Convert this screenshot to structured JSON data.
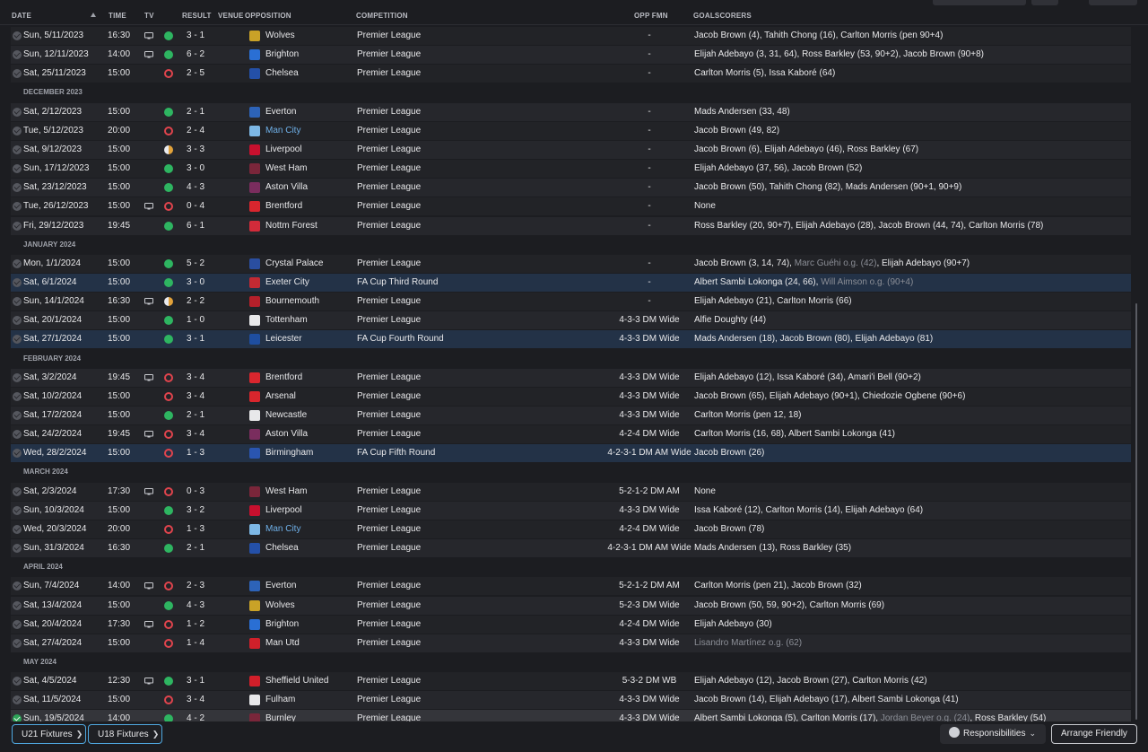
{
  "headers": {
    "date": "DATE",
    "time": "TIME",
    "tv": "TV",
    "result": "RESULT",
    "venue": "VENUE",
    "opposition": "OPPOSITION",
    "competition": "COMPETITION",
    "opp_fmn": "OPP FMN",
    "goalscorers": "GOALSCORERS"
  },
  "colors": {
    "win": "#2eb561",
    "loss": "#e0444d",
    "draw": "#e2a23a",
    "cup_row": "#233247",
    "man_city_link": "#6fb0e8",
    "button_border": "#4fa8e0"
  },
  "sections": [
    {
      "month": "",
      "fixtures": [
        {
          "date": "Sun, 5/11/2023",
          "time": "16:30",
          "tv": true,
          "result": "W",
          "score": "3 - 1",
          "venue": "A",
          "opponent": "Wolves",
          "crest": "#c9a227",
          "competition": "Premier League",
          "opp_fmn": "-",
          "goals": [
            {
              "t": "Jacob Brown (4), Tahith Chong (16), Carlton Morris (pen 90+4)"
            }
          ]
        },
        {
          "date": "Sun, 12/11/2023",
          "time": "14:00",
          "tv": true,
          "result": "W",
          "score": "6 - 2",
          "venue": "H",
          "opponent": "Brighton",
          "crest": "#2a6fd4",
          "competition": "Premier League",
          "opp_fmn": "-",
          "goals": [
            {
              "t": "Elijah Adebayo (3, 31, 64), Ross Barkley (53, 90+2), Jacob Brown (90+8)"
            }
          ]
        },
        {
          "date": "Sat, 25/11/2023",
          "time": "15:00",
          "tv": false,
          "result": "L",
          "score": "2 - 5",
          "venue": "A",
          "opponent": "Chelsea",
          "crest": "#2450a8",
          "competition": "Premier League",
          "opp_fmn": "-",
          "goals": [
            {
              "t": "Carlton Morris (5), Issa Kaboré (64)"
            }
          ]
        }
      ]
    },
    {
      "month": "DECEMBER 2023",
      "fixtures": [
        {
          "date": "Sat, 2/12/2023",
          "time": "15:00",
          "tv": false,
          "result": "W",
          "score": "2 - 1",
          "venue": "H",
          "opponent": "Everton",
          "crest": "#2d63b8",
          "competition": "Premier League",
          "opp_fmn": "-",
          "goals": [
            {
              "t": "Mads Andersen (33, 48)"
            }
          ]
        },
        {
          "date": "Tue, 5/12/2023",
          "time": "20:00",
          "tv": false,
          "result": "L",
          "score": "2 - 4",
          "venue": "H",
          "opponent": "Man City",
          "crest": "#7db8e6",
          "link": true,
          "competition": "Premier League",
          "opp_fmn": "-",
          "goals": [
            {
              "t": "Jacob Brown (49, 82)"
            }
          ]
        },
        {
          "date": "Sat, 9/12/2023",
          "time": "15:00",
          "tv": false,
          "result": "D",
          "score": "3 - 3",
          "venue": "A",
          "opponent": "Liverpool",
          "crest": "#c8102e",
          "competition": "Premier League",
          "opp_fmn": "-",
          "goals": [
            {
              "t": "Jacob Brown (6), Elijah Adebayo (46), Ross Barkley (67)"
            }
          ]
        },
        {
          "date": "Sun, 17/12/2023",
          "time": "15:00",
          "tv": false,
          "result": "W",
          "score": "3 - 0",
          "venue": "H",
          "opponent": "West Ham",
          "crest": "#7a263a",
          "competition": "Premier League",
          "opp_fmn": "-",
          "goals": [
            {
              "t": "Elijah Adebayo (37, 56), Jacob Brown (52)"
            }
          ]
        },
        {
          "date": "Sat, 23/12/2023",
          "time": "15:00",
          "tv": false,
          "result": "W",
          "score": "4 - 3",
          "venue": "A",
          "opponent": "Aston Villa",
          "crest": "#7a2d5e",
          "competition": "Premier League",
          "opp_fmn": "-",
          "goals": [
            {
              "t": "Jacob Brown (50), Tahith Chong (82), Mads Andersen (90+1, 90+9)"
            }
          ]
        },
        {
          "date": "Tue, 26/12/2023",
          "time": "15:00",
          "tv": true,
          "result": "L",
          "score": "0 - 4",
          "venue": "A",
          "opponent": "Brentford",
          "crest": "#d9262e",
          "competition": "Premier League",
          "opp_fmn": "-",
          "goals": [
            {
              "t": "None"
            }
          ]
        },
        {
          "date": "Fri, 29/12/2023",
          "time": "19:45",
          "tv": false,
          "result": "W",
          "score": "6 - 1",
          "venue": "H",
          "opponent": "Nottm Forest",
          "crest": "#d22b3a",
          "competition": "Premier League",
          "opp_fmn": "-",
          "goals": [
            {
              "t": "Ross Barkley (20, 90+7), Elijah Adebayo (28), Jacob Brown (44, 74), Carlton Morris (78)"
            }
          ]
        }
      ]
    },
    {
      "month": "JANUARY 2024",
      "fixtures": [
        {
          "date": "Mon, 1/1/2024",
          "time": "15:00",
          "tv": false,
          "result": "W",
          "score": "5 - 2",
          "venue": "A",
          "opponent": "Crystal Palace",
          "crest": "#2a4ea0",
          "competition": "Premier League",
          "opp_fmn": "-",
          "goals": [
            {
              "t": "Jacob Brown (3, 14, 74), "
            },
            {
              "t": "Marc Guéhi o.g. (42)",
              "og": true
            },
            {
              "t": ", Elijah Adebayo (90+7)"
            }
          ]
        },
        {
          "date": "Sat, 6/1/2024",
          "time": "15:00",
          "tv": false,
          "result": "W",
          "score": "3 - 0",
          "venue": "A",
          "opponent": "Exeter City",
          "crest": "#c22a33",
          "competition": "FA Cup Third Round",
          "cup": true,
          "opp_fmn": "-",
          "goals": [
            {
              "t": "Albert Sambi Lokonga (24, 66), "
            },
            {
              "t": "Will Aimson o.g. (90+4)",
              "og": true
            }
          ]
        },
        {
          "date": "Sun, 14/1/2024",
          "time": "16:30",
          "tv": true,
          "result": "D",
          "score": "2 - 2",
          "venue": "H",
          "opponent": "Bournemouth",
          "crest": "#b5202a",
          "competition": "Premier League",
          "opp_fmn": "-",
          "goals": [
            {
              "t": "Elijah Adebayo (21), Carlton Morris (66)"
            }
          ]
        },
        {
          "date": "Sat, 20/1/2024",
          "time": "15:00",
          "tv": false,
          "result": "W",
          "score": "1 - 0",
          "venue": "A",
          "opponent": "Tottenham",
          "crest": "#e8e8ea",
          "competition": "Premier League",
          "opp_fmn": "4-3-3 DM Wide",
          "goals": [
            {
              "t": "Alfie Doughty (44)"
            }
          ]
        },
        {
          "date": "Sat, 27/1/2024",
          "time": "15:00",
          "tv": false,
          "result": "W",
          "score": "3 - 1",
          "venue": "H",
          "opponent": "Leicester",
          "crest": "#1e4ea0",
          "competition": "FA Cup Fourth Round",
          "cup": true,
          "opp_fmn": "4-3-3 DM Wide",
          "goals": [
            {
              "t": "Mads Andersen (18), Jacob Brown (80), Elijah Adebayo (81)"
            }
          ]
        }
      ]
    },
    {
      "month": "FEBRUARY 2024",
      "fixtures": [
        {
          "date": "Sat, 3/2/2024",
          "time": "19:45",
          "tv": true,
          "result": "L",
          "score": "3 - 4",
          "venue": "H",
          "opponent": "Brentford",
          "crest": "#d9262e",
          "competition": "Premier League",
          "opp_fmn": "4-3-3 DM Wide",
          "goals": [
            {
              "t": "Elijah Adebayo (12), Issa Kaboré (34), Amari'i Bell (90+2)"
            }
          ]
        },
        {
          "date": "Sat, 10/2/2024",
          "time": "15:00",
          "tv": false,
          "result": "L",
          "score": "3 - 4",
          "venue": "A",
          "opponent": "Arsenal",
          "crest": "#d8262d",
          "competition": "Premier League",
          "opp_fmn": "4-3-3 DM Wide",
          "goals": [
            {
              "t": "Jacob Brown (65), Elijah Adebayo (90+1), Chiedozie Ogbene (90+6)"
            }
          ]
        },
        {
          "date": "Sat, 17/2/2024",
          "time": "15:00",
          "tv": false,
          "result": "W",
          "score": "2 - 1",
          "venue": "H",
          "opponent": "Newcastle",
          "crest": "#e8e8ea",
          "competition": "Premier League",
          "opp_fmn": "4-3-3 DM Wide",
          "goals": [
            {
              "t": "Carlton Morris (pen 12, 18)"
            }
          ]
        },
        {
          "date": "Sat, 24/2/2024",
          "time": "19:45",
          "tv": true,
          "result": "L",
          "score": "3 - 4",
          "venue": "A",
          "opponent": "Aston Villa",
          "crest": "#7a2d5e",
          "competition": "Premier League",
          "opp_fmn": "4-2-4 DM Wide",
          "goals": [
            {
              "t": "Carlton Morris (16, 68), Albert Sambi Lokonga (41)"
            }
          ]
        },
        {
          "date": "Wed, 28/2/2024",
          "time": "15:00",
          "tv": false,
          "result": "L",
          "score": "1 - 3",
          "venue": "H",
          "opponent": "Birmingham",
          "crest": "#2a55b0",
          "competition": "FA Cup Fifth Round",
          "cup": true,
          "opp_fmn": "4-2-3-1 DM AM Wide",
          "goals": [
            {
              "t": "Jacob Brown (26)"
            }
          ]
        }
      ]
    },
    {
      "month": "MARCH 2024",
      "fixtures": [
        {
          "date": "Sat, 2/3/2024",
          "time": "17:30",
          "tv": true,
          "result": "L",
          "score": "0 - 3",
          "venue": "A",
          "opponent": "West Ham",
          "crest": "#7a263a",
          "competition": "Premier League",
          "opp_fmn": "5-2-1-2 DM AM",
          "goals": [
            {
              "t": "None"
            }
          ]
        },
        {
          "date": "Sun, 10/3/2024",
          "time": "15:00",
          "tv": false,
          "result": "W",
          "score": "3 - 2",
          "venue": "H",
          "opponent": "Liverpool",
          "crest": "#c8102e",
          "competition": "Premier League",
          "opp_fmn": "4-3-3 DM Wide",
          "goals": [
            {
              "t": "Issa Kaboré (12), Carlton Morris (14), Elijah Adebayo (64)"
            }
          ]
        },
        {
          "date": "Wed, 20/3/2024",
          "time": "20:00",
          "tv": false,
          "result": "L",
          "score": "1 - 3",
          "venue": "A",
          "opponent": "Man City",
          "crest": "#7db8e6",
          "link": true,
          "competition": "Premier League",
          "opp_fmn": "4-2-4 DM Wide",
          "goals": [
            {
              "t": "Jacob Brown (78)"
            }
          ]
        },
        {
          "date": "Sun, 31/3/2024",
          "time": "16:30",
          "tv": false,
          "result": "W",
          "score": "2 - 1",
          "venue": "H",
          "opponent": "Chelsea",
          "crest": "#2450a8",
          "competition": "Premier League",
          "opp_fmn": "4-2-3-1 DM AM Wide",
          "goals": [
            {
              "t": "Mads Andersen (13), Ross Barkley (35)"
            }
          ]
        }
      ]
    },
    {
      "month": "APRIL 2024",
      "fixtures": [
        {
          "date": "Sun, 7/4/2024",
          "time": "14:00",
          "tv": true,
          "result": "L",
          "score": "2 - 3",
          "venue": "A",
          "opponent": "Everton",
          "crest": "#2d63b8",
          "competition": "Premier League",
          "opp_fmn": "5-2-1-2 DM AM",
          "goals": [
            {
              "t": "Carlton Morris (pen 21), Jacob Brown (32)"
            }
          ]
        },
        {
          "date": "Sat, 13/4/2024",
          "time": "15:00",
          "tv": false,
          "result": "W",
          "score": "4 - 3",
          "venue": "H",
          "opponent": "Wolves",
          "crest": "#c9a227",
          "competition": "Premier League",
          "opp_fmn": "5-2-3 DM Wide",
          "goals": [
            {
              "t": "Jacob Brown (50, 59, 90+2), Carlton Morris (69)"
            }
          ]
        },
        {
          "date": "Sat, 20/4/2024",
          "time": "17:30",
          "tv": true,
          "result": "L",
          "score": "1 - 2",
          "venue": "A",
          "opponent": "Brighton",
          "crest": "#2a6fd4",
          "competition": "Premier League",
          "opp_fmn": "4-2-4 DM Wide",
          "goals": [
            {
              "t": "Elijah Adebayo (30)"
            }
          ]
        },
        {
          "date": "Sat, 27/4/2024",
          "time": "15:00",
          "tv": false,
          "result": "L",
          "score": "1 - 4",
          "venue": "A",
          "opponent": "Man Utd",
          "crest": "#d0202a",
          "competition": "Premier League",
          "opp_fmn": "4-3-3 DM Wide",
          "goals": [
            {
              "t": "Lisandro Martínez o.g. (62)",
              "og": true
            }
          ]
        }
      ]
    },
    {
      "month": "MAY 2024",
      "fixtures": [
        {
          "date": "Sat, 4/5/2024",
          "time": "12:30",
          "tv": true,
          "result": "W",
          "score": "3 - 1",
          "venue": "H",
          "opponent": "Sheffield United",
          "crest": "#d21f2a",
          "competition": "Premier League",
          "opp_fmn": "5-3-2 DM WB",
          "goals": [
            {
              "t": "Elijah Adebayo (12), Jacob Brown (27), Carlton Morris (42)"
            }
          ]
        },
        {
          "date": "Sat, 11/5/2024",
          "time": "15:00",
          "tv": false,
          "result": "L",
          "score": "3 - 4",
          "venue": "A",
          "opponent": "Fulham",
          "crest": "#e8e8ea",
          "competition": "Premier League",
          "opp_fmn": "4-3-3 DM Wide",
          "goals": [
            {
              "t": "Jacob Brown (14), Elijah Adebayo (17), Albert Sambi Lokonga (41)"
            }
          ]
        },
        {
          "date": "Sun, 19/5/2024",
          "time": "14:00",
          "tv": false,
          "result": "W",
          "score": "4 - 2",
          "venue": "H",
          "opponent": "Burnley",
          "crest": "#7a263a",
          "next": true,
          "competition": "Premier League",
          "opp_fmn": "4-3-3 DM Wide",
          "goals": [
            {
              "t": "Albert Sambi Lokonga (5), Carlton Morris (17), "
            },
            {
              "t": "Jordan Beyer o.g. (24)",
              "og": true
            },
            {
              "t": ", Ross Barkley (54)"
            }
          ]
        }
      ]
    }
  ],
  "footer": {
    "u21": "U21 Fixtures",
    "u18": "U18 Fixtures",
    "responsibilities": "Responsibilities",
    "arrange_friendly": "Arrange Friendly"
  }
}
